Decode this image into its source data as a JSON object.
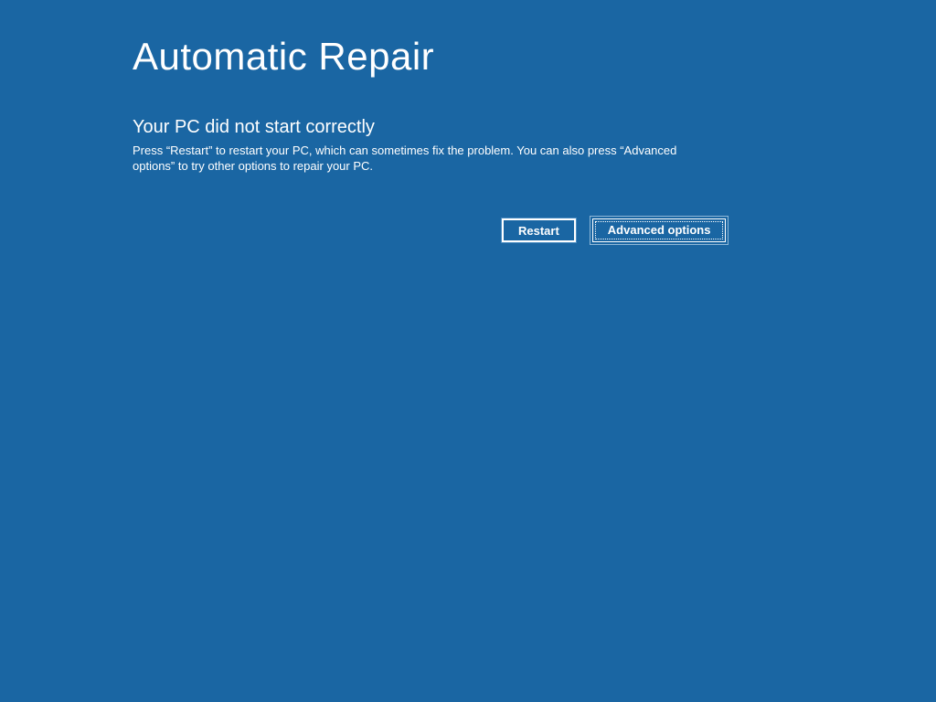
{
  "page": {
    "title": "Automatic Repair",
    "subtitle": "Your PC did not start correctly",
    "description": "Press “Restart” to restart your PC, which can sometimes fix the problem. You can also press “Advanced options” to try other options to repair your PC."
  },
  "buttons": {
    "restart": "Restart",
    "advanced": "Advanced options"
  }
}
